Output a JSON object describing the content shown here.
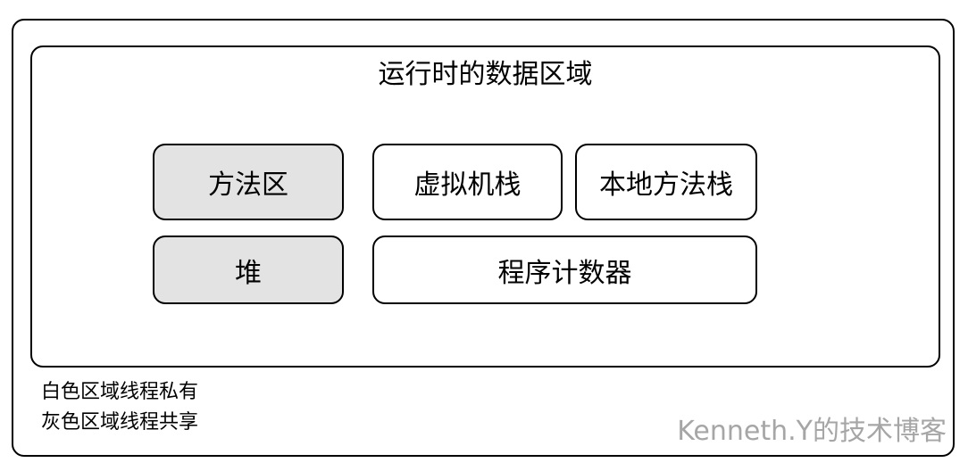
{
  "diagram": {
    "title": "运行时的数据区域",
    "areas": [
      {
        "label": "方法区",
        "shading": "gray"
      },
      {
        "label": "虚拟机栈",
        "shading": "white"
      },
      {
        "label": "本地方法栈",
        "shading": "white"
      },
      {
        "label": "堆",
        "shading": "gray"
      },
      {
        "label": "程序计数器",
        "shading": "white"
      }
    ],
    "legend": [
      "白色区域线程私有",
      "灰色区域线程共享"
    ],
    "watermark": "Kenneth.Y的技术博客"
  },
  "colors": {
    "shared_fill": "#e3e3e3",
    "private_fill": "#ffffff",
    "border": "#000000",
    "watermark": "#a6a6a6"
  }
}
